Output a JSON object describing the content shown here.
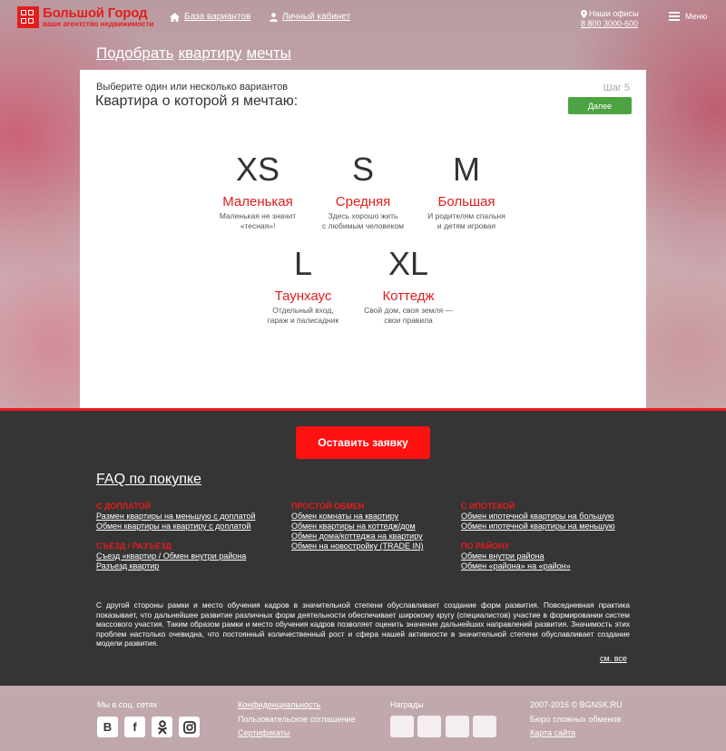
{
  "header": {
    "logo_name": "Большой Город",
    "logo_sub": "ваше агентство недвижимости",
    "nav": [
      "База вариантов",
      "Личный кабинет"
    ],
    "offices_label": "Наши офисы",
    "phone": "8 800 3000-600",
    "menu_label": "Меню"
  },
  "page_title": [
    "Подобрать",
    "квартиру",
    "мечты"
  ],
  "card": {
    "subtitle": "Выберите один или несколько вариантов",
    "title": "Квартира о которой я мечтаю:",
    "step": "Шаг 5",
    "next": "Далее",
    "options": [
      {
        "size": "XS",
        "name": "Маленькая",
        "desc1": "Маленькая не значит",
        "desc2": "«тесная»!"
      },
      {
        "size": "S",
        "name": "Средняя",
        "desc1": "Здесь хорошо жить",
        "desc2": "с любимым человеком"
      },
      {
        "size": "M",
        "name": "Большая",
        "desc1": "И родителям спальня",
        "desc2": "и детям игровая"
      },
      {
        "size": "L",
        "name": "Таунхаус",
        "desc1": "Отдельный вход,",
        "desc2": "гараж и палисадник"
      },
      {
        "size": "XL",
        "name": "Коттедж",
        "desc1": "Свой дом, своя земля —",
        "desc2": "свои правила"
      }
    ]
  },
  "cta": "Оставить заявку",
  "faq": {
    "title": "FAQ по покупке",
    "groups": [
      {
        "title": "С ДОПЛАТОЙ",
        "links": [
          "Размен квартиры на меньшую с доплатой",
          "Обмен квартиры на квартиру с доплатой"
        ]
      },
      {
        "title": "ПРОСТОЙ ОБМЕН",
        "links": [
          "Обмен комнаты на квартиру",
          "Обмен квартиры на коттедж/дом",
          "Обмен дома/коттеджа на квартиру",
          "Обмен на новостройку (TRADE IN)"
        ]
      },
      {
        "title": "С ИПОТЕКОЙ",
        "links": [
          "Обмен ипотечной квартиры на большую",
          "Обмен ипотечной квартиры на меньшую"
        ]
      },
      {
        "title": "СЪЕЗД / РАЗЪЕЗД",
        "links": [
          "Съезд «квартир / Обмен внутри района",
          "Разъезд квартир"
        ]
      },
      {
        "title": "ПО РАЙОНУ",
        "links": [
          "Обмен внутри района",
          "Обмен «района» на «район»"
        ]
      }
    ],
    "text": "С другой стороны рамки и место обучения кадров в значительной степени обуславливает создание форм развития. Повседневная практика показывает, что дальнейшее развитие различных форм деятельности обеспечивает широкому кругу (специалистов) участие в формировании систем массового участия. Таким образом рамки и место обучения кадров позволяет оценить значение дальнейших направлений развития. Значимость этих проблем настолько очевидна, что постоянный количественный рост и сфера нашей активности в значительной степени обуславливает создание модели развития.",
    "see_all": "см. все"
  },
  "footer": {
    "social_label": "Мы в соц. сетях",
    "social": [
      "B",
      "f",
      "ok",
      "ig"
    ],
    "links": [
      "Конфиденциальность",
      "Пользовательское соглашение",
      "Сертификаты"
    ],
    "awards_label": "Награды",
    "copyright": "2007-2016 © BGNSK.RU",
    "bureau": "Бюро сложных обменов",
    "sitemap": "Карта сайта"
  },
  "colors": {
    "accent": "#e41d1d",
    "cta": "#ff1111",
    "next": "#4ca341",
    "dark": "#353535"
  }
}
